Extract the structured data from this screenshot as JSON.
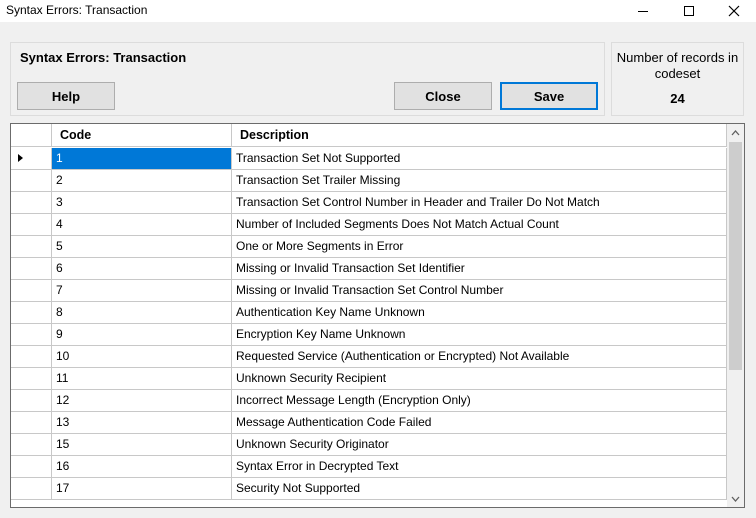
{
  "window": {
    "title": "Syntax Errors: Transaction"
  },
  "header": {
    "title": "Syntax Errors: Transaction",
    "help_label": "Help",
    "close_label": "Close",
    "save_label": "Save"
  },
  "records": {
    "label": "Number of records in codeset",
    "count": "24"
  },
  "grid": {
    "columns": [
      "Code",
      "Description"
    ],
    "rows": [
      {
        "code": "1",
        "description": "Transaction Set Not Supported"
      },
      {
        "code": "2",
        "description": "Transaction Set Trailer Missing"
      },
      {
        "code": "3",
        "description": "Transaction Set Control Number in Header and Trailer Do Not Match"
      },
      {
        "code": "4",
        "description": "Number of Included Segments Does Not Match Actual Count"
      },
      {
        "code": "5",
        "description": "One or More Segments in Error"
      },
      {
        "code": "6",
        "description": "Missing or Invalid Transaction Set Identifier"
      },
      {
        "code": "7",
        "description": "Missing or Invalid Transaction Set Control Number"
      },
      {
        "code": "8",
        "description": "Authentication Key Name Unknown"
      },
      {
        "code": "9",
        "description": "Encryption Key Name Unknown"
      },
      {
        "code": "10",
        "description": "Requested Service (Authentication or Encrypted) Not Available"
      },
      {
        "code": "11",
        "description": "Unknown Security Recipient"
      },
      {
        "code": "12",
        "description": "Incorrect Message Length (Encryption Only)"
      },
      {
        "code": "13",
        "description": "Message Authentication Code Failed"
      },
      {
        "code": "15",
        "description": "Unknown Security Originator"
      },
      {
        "code": "16",
        "description": "Syntax Error in Decrypted Text"
      },
      {
        "code": "17",
        "description": "Security Not Supported"
      }
    ],
    "selected_row": 0
  },
  "icons": {
    "minimize": "minimize-icon",
    "maximize": "maximize-icon",
    "close": "close-icon",
    "row_pointer": "row-pointer-icon",
    "scroll_up": "chevron-up-icon",
    "scroll_down": "chevron-down-icon"
  },
  "colors": {
    "selection": "#0078d7",
    "default_button_border": "#0078d7"
  }
}
